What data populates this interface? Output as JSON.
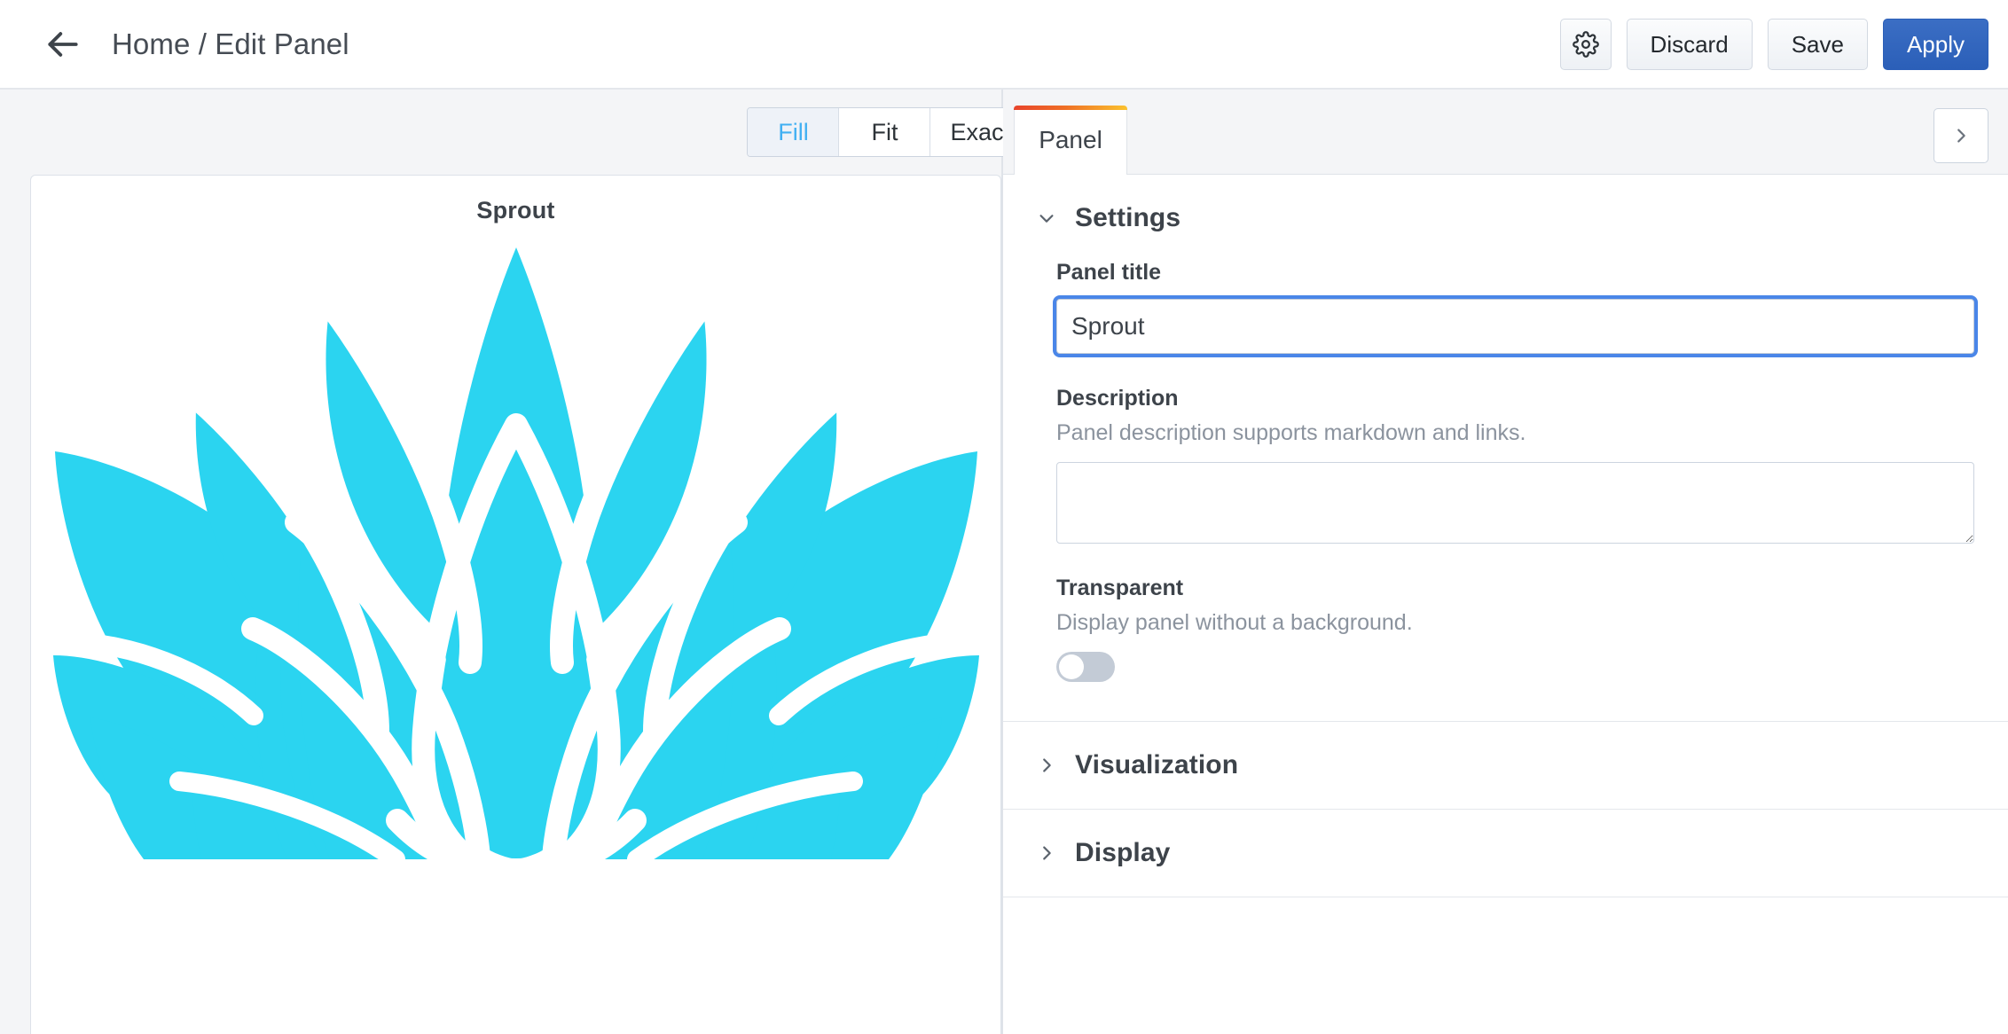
{
  "header": {
    "back_icon": "arrow-left-icon",
    "breadcrumb": "Home / Edit Panel",
    "settings_icon": "gear-icon",
    "discard_label": "Discard",
    "save_label": "Save",
    "apply_label": "Apply",
    "apply_color": "#2b5fb8"
  },
  "preview": {
    "size_modes": [
      {
        "label": "Fill",
        "active": true
      },
      {
        "label": "Fit",
        "active": false
      },
      {
        "label": "Exact",
        "active": false
      }
    ],
    "panel_title": "Sprout",
    "image_name": "lotus-flower-logo",
    "image_color": "#2BD4F0"
  },
  "options": {
    "tabs": [
      {
        "label": "Panel",
        "active": true
      }
    ],
    "expand_icon": "chevron-right-icon",
    "sections": [
      {
        "title": "Settings",
        "expanded": true,
        "chevron": "chevron-down-icon"
      },
      {
        "title": "Visualization",
        "expanded": false,
        "chevron": "chevron-right-icon"
      },
      {
        "title": "Display",
        "expanded": false,
        "chevron": "chevron-right-icon"
      }
    ],
    "settings": {
      "panel_title": {
        "label": "Panel title",
        "value": "Sprout",
        "placeholder": ""
      },
      "description": {
        "label": "Description",
        "help": "Panel description supports markdown and links.",
        "value": "",
        "placeholder": ""
      },
      "transparent": {
        "label": "Transparent",
        "help": "Display panel without a background.",
        "enabled": false
      }
    }
  }
}
